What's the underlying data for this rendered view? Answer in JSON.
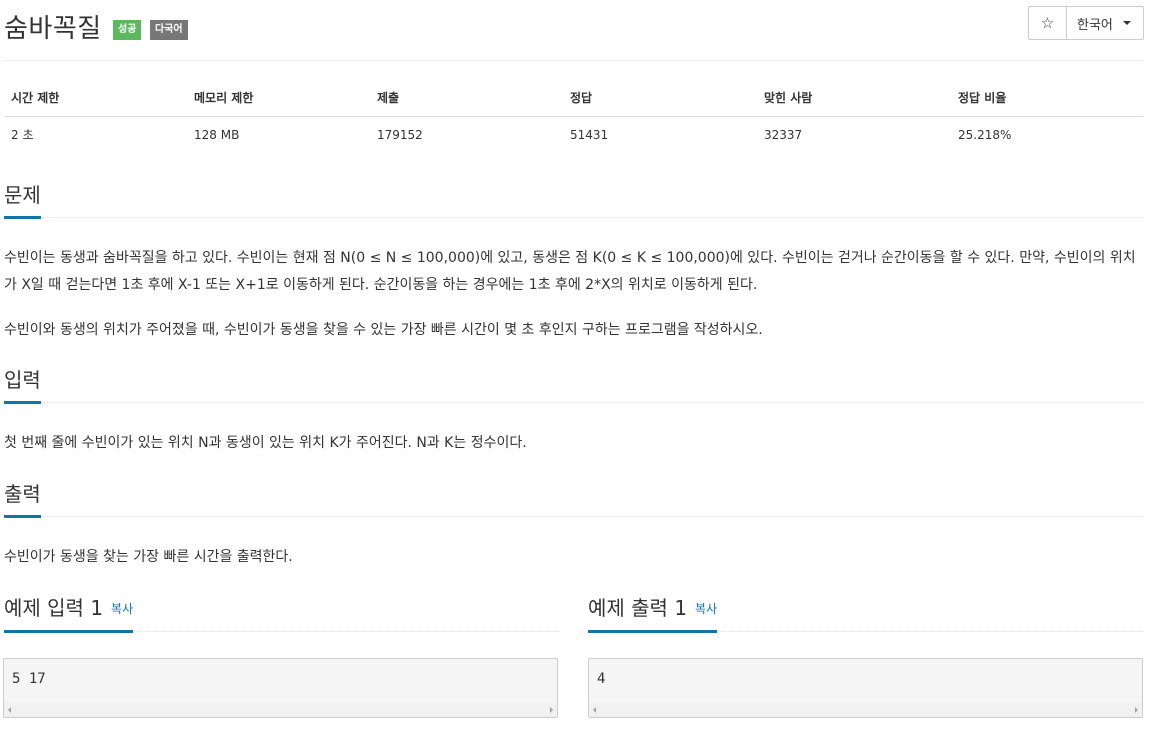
{
  "header": {
    "title": "숨바꼭질",
    "badge_success": "성공",
    "badge_multilang": "다국어",
    "star_icon": "☆",
    "language": "한국어"
  },
  "info_table": {
    "headers": [
      "시간 제한",
      "메모리 제한",
      "제출",
      "정답",
      "맞힌 사람",
      "정답 비율"
    ],
    "values": [
      "2 초",
      "128 MB",
      "179152",
      "51431",
      "32337",
      "25.218%"
    ]
  },
  "sections": {
    "problem": {
      "title": "문제",
      "p1": "수빈이는 동생과 숨바꼭질을 하고 있다. 수빈이는 현재 점 N(0 ≤ N ≤ 100,000)에 있고, 동생은 점 K(0 ≤ K ≤ 100,000)에 있다. 수빈이는 걷거나 순간이동을 할 수 있다. 만약, 수빈이의 위치가 X일 때 걷는다면 1초 후에 X-1 또는 X+1로 이동하게 된다. 순간이동을 하는 경우에는 1초 후에 2*X의 위치로 이동하게 된다.",
      "p2": "수빈이와 동생의 위치가 주어졌을 때, 수빈이가 동생을 찾을 수 있는 가장 빠른 시간이 몇 초 후인지 구하는 프로그램을 작성하시오."
    },
    "input": {
      "title": "입력",
      "p1": "첫 번째 줄에 수빈이가 있는 위치 N과 동생이 있는 위치 K가 주어진다. N과 K는 정수이다."
    },
    "output": {
      "title": "출력",
      "p1": "수빈이가 동생을 찾는 가장 빠른 시간을 출력한다."
    }
  },
  "samples": {
    "input_title": "예제 입력 1",
    "output_title": "예제 출력 1",
    "copy_label": "복사",
    "input_value": "5 17",
    "output_value": "4"
  }
}
